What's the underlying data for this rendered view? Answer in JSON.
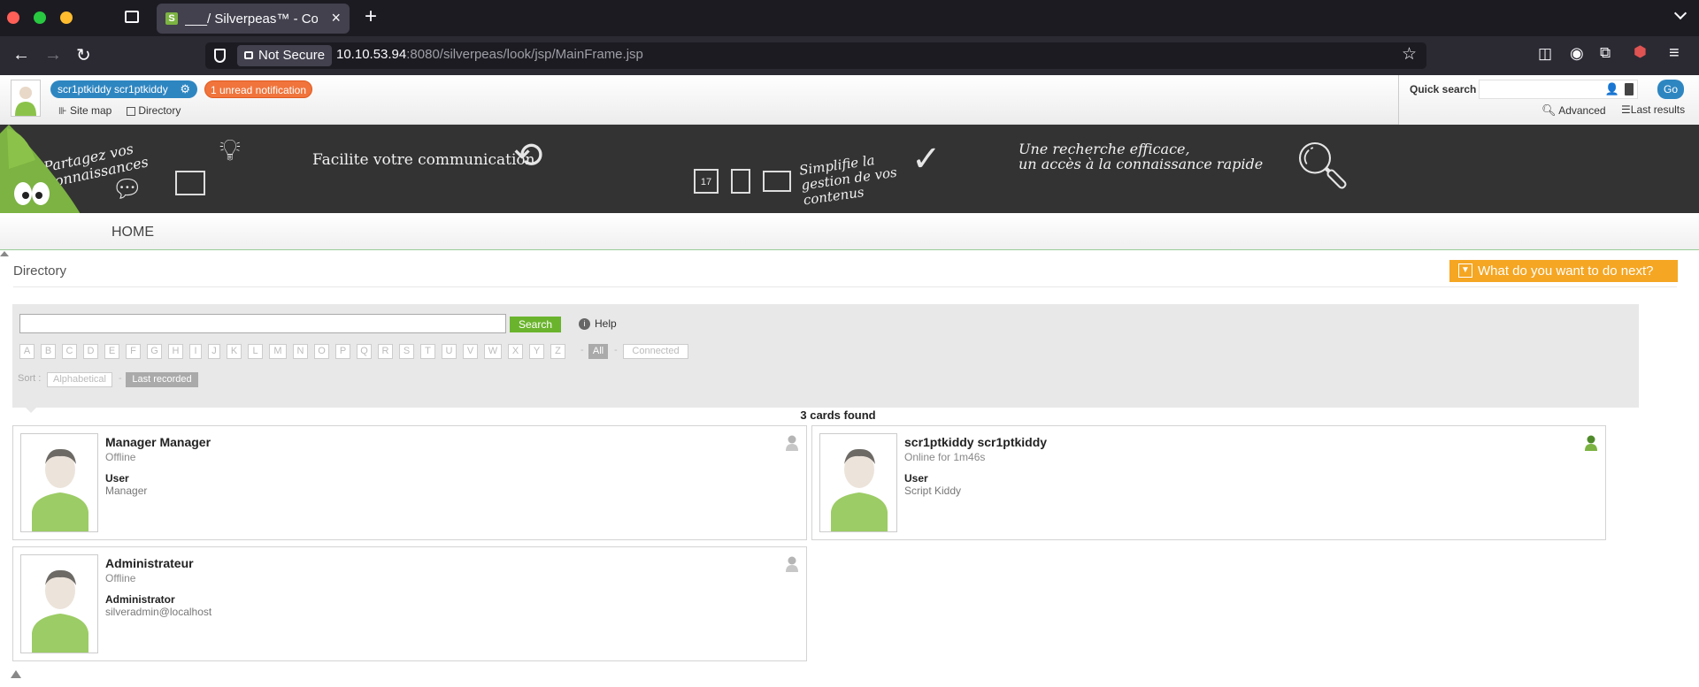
{
  "browser": {
    "tab_title": "___/ Silverpeas™ - Collaborative",
    "tab_close": "×",
    "new_tab": "+",
    "not_secure": "Not Secure",
    "url_host": "10.10.53.94",
    "url_path": ":8080/silverpeas/look/jsp/MainFrame.jsp"
  },
  "topbar": {
    "user_name": "scr1ptkiddy scr1ptkiddy",
    "notification": "1 unread notification",
    "site_map": "Site map",
    "directory": "Directory",
    "quick_search_label": "Quick search",
    "go": "Go",
    "advanced": "Advanced",
    "last_results": "Last results"
  },
  "banner": {
    "text1": "Partagez vos connaissances",
    "text2": "Facilite votre communication",
    "text3": "Simplifie la gestion de vos contenus",
    "text4_line1": "Une recherche efficace,",
    "text4_line2": "un accès à la connaissance rapide",
    "calendar_day": "17"
  },
  "menu": {
    "home": "HOME"
  },
  "directory": {
    "title": "Directory",
    "next_action": "What do you want to do next?",
    "search_button": "Search",
    "help": "Help",
    "letters": [
      "A",
      "B",
      "C",
      "D",
      "E",
      "F",
      "G",
      "H",
      "I",
      "J",
      "K",
      "L",
      "M",
      "N",
      "O",
      "P",
      "Q",
      "R",
      "S",
      "T",
      "U",
      "V",
      "W",
      "X",
      "Y",
      "Z"
    ],
    "all": "All",
    "connected": "Connected",
    "sort_label": "Sort :",
    "sort_alpha": "Alphabetical",
    "sort_last": "Last recorded",
    "results": "3 cards found"
  },
  "cards": [
    {
      "name": "Manager Manager",
      "status": "Offline",
      "role": "User",
      "detail": "Manager",
      "online": false
    },
    {
      "name": "scr1ptkiddy scr1ptkiddy",
      "status": "Online for 1m46s",
      "role": "User",
      "detail": "Script Kiddy",
      "online": true
    },
    {
      "name": "Administrateur",
      "status": "Offline",
      "role": "Administrator",
      "detail": "silveradmin@localhost",
      "online": false
    }
  ],
  "colors": {
    "accent_green": "#6ab42d",
    "accent_blue": "#2e86c1",
    "accent_orange": "#f5a623",
    "notification_orange": "#f0743b"
  }
}
